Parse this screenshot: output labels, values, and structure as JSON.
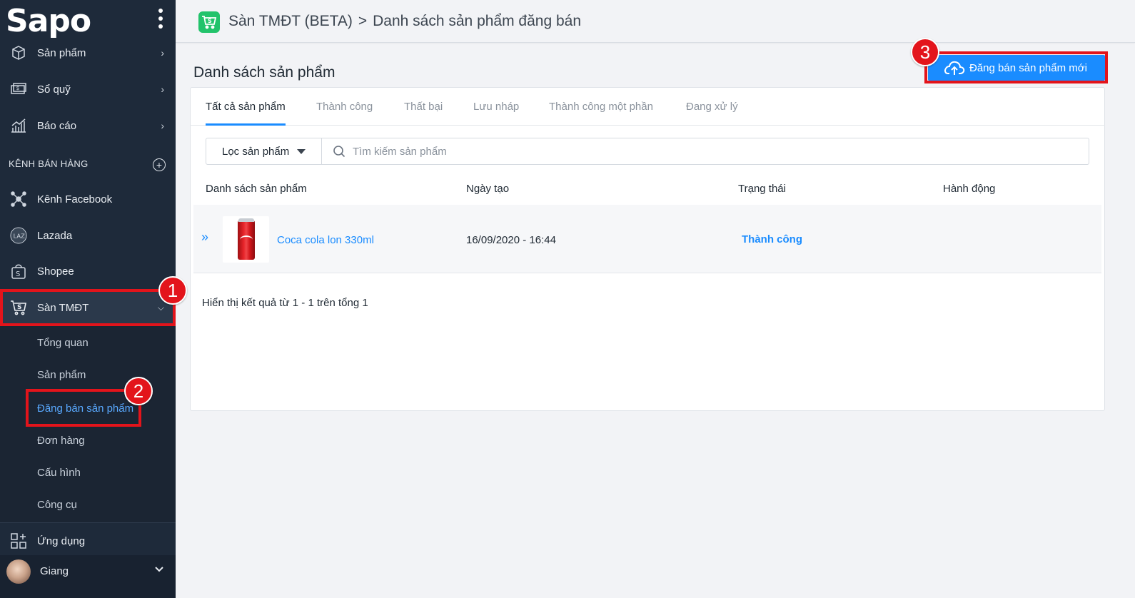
{
  "app": {
    "logo": "Sapo"
  },
  "sidebar": {
    "items": [
      {
        "label": "Sản phẩm",
        "icon": "box-icon"
      },
      {
        "label": "Sổ quỹ",
        "icon": "cash-icon"
      },
      {
        "label": "Báo cáo",
        "icon": "chart-icon"
      }
    ],
    "section_title": "KÊNH BÁN HÀNG",
    "channels": [
      {
        "label": "Kênh Facebook",
        "icon": "network-icon"
      },
      {
        "label": "Lazada",
        "icon": "lazada-icon"
      },
      {
        "label": "Shopee",
        "icon": "shopee-bag-icon"
      },
      {
        "label": "Sàn TMĐT",
        "icon": "cart-icon"
      }
    ],
    "sub_items": [
      "Tổng quan",
      "Sản phẩm",
      "Đăng bán sản phẩm",
      "Đơn hàng",
      "Cấu hình",
      "Công cụ"
    ],
    "apps_label": "Ứng dụng",
    "user_name": "Giang"
  },
  "annotations": [
    "1",
    "2",
    "3"
  ],
  "header": {
    "breadcrumb_root": "Sàn TMĐT (BETA)",
    "breadcrumb_sep": ">",
    "breadcrumb_current": "Danh sách sản phẩm đăng bán"
  },
  "main": {
    "title": "Danh sách sản phẩm",
    "new_button": "Đăng bán sản phẩm mới",
    "tabs": [
      "Tất cả sản phẩm",
      "Thành công",
      "Thất bại",
      "Lưu nháp",
      "Thành công một phần",
      "Đang xử lý"
    ],
    "filter_label": "Lọc sản phẩm",
    "search_placeholder": "Tìm kiếm sản phẩm",
    "columns": [
      "Danh sách sản phẩm",
      "Ngày tạo",
      "Trạng thái",
      "Hành động"
    ],
    "rows": [
      {
        "name": "Coca cola lon 330ml",
        "created": "16/09/2020 - 16:44",
        "status": "Thành công"
      }
    ],
    "result_text": "Hiển thị kết quả từ 1 - 1 trên tổng 1"
  },
  "colors": {
    "sidebar": "#1e2a3a",
    "accent": "#1a8cff",
    "annotation": "#e3141b",
    "shop_icon": "#22c36b"
  }
}
